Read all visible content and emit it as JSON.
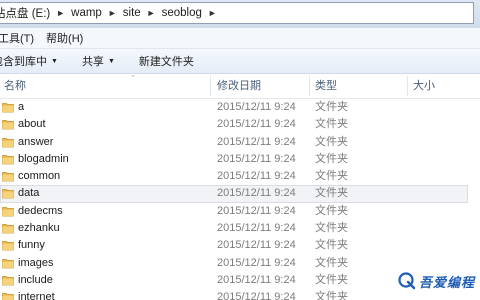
{
  "address_bar": {
    "crumbs": [
      "站点盘 (E:)",
      "wamp",
      "site",
      "seoblog"
    ]
  },
  "menu": {
    "items": [
      "工具(T)",
      "帮助(H)"
    ]
  },
  "toolbar": {
    "include_in_library": "包含到库中",
    "share": "共享",
    "new_folder": "新建文件夹"
  },
  "columns": {
    "name": "名称",
    "date_modified": "修改日期",
    "type": "类型",
    "size": "大小"
  },
  "files": [
    {
      "name": "a",
      "date": "2015/12/11 9:24",
      "type": "文件夹"
    },
    {
      "name": "about",
      "date": "2015/12/11 9:24",
      "type": "文件夹"
    },
    {
      "name": "answer",
      "date": "2015/12/11 9:24",
      "type": "文件夹"
    },
    {
      "name": "blogadmin",
      "date": "2015/12/11 9:24",
      "type": "文件夹"
    },
    {
      "name": "common",
      "date": "2015/12/11 9:24",
      "type": "文件夹"
    },
    {
      "name": "data",
      "date": "2015/12/11 9:24",
      "type": "文件夹",
      "selected": true
    },
    {
      "name": "dedecms",
      "date": "2015/12/11 9:24",
      "type": "文件夹"
    },
    {
      "name": "ezhanku",
      "date": "2015/12/11 9:24",
      "type": "文件夹"
    },
    {
      "name": "funny",
      "date": "2015/12/11 9:24",
      "type": "文件夹"
    },
    {
      "name": "images",
      "date": "2015/12/11 9:24",
      "type": "文件夹"
    },
    {
      "name": "include",
      "date": "2015/12/11 9:24",
      "type": "文件夹"
    },
    {
      "name": "internet",
      "date": "2015/12/11 9:24",
      "type": "文件夹"
    }
  ],
  "watermark": {
    "text": "吾爱编程",
    "icon": "q-logo-icon",
    "color": "#1f5cb4"
  },
  "icons": {
    "folder": "folder-icon",
    "breadcrumb_separator": "chevron-right-icon",
    "dropdown": "chevron-down-icon",
    "sort": "sort-caret-icon"
  }
}
